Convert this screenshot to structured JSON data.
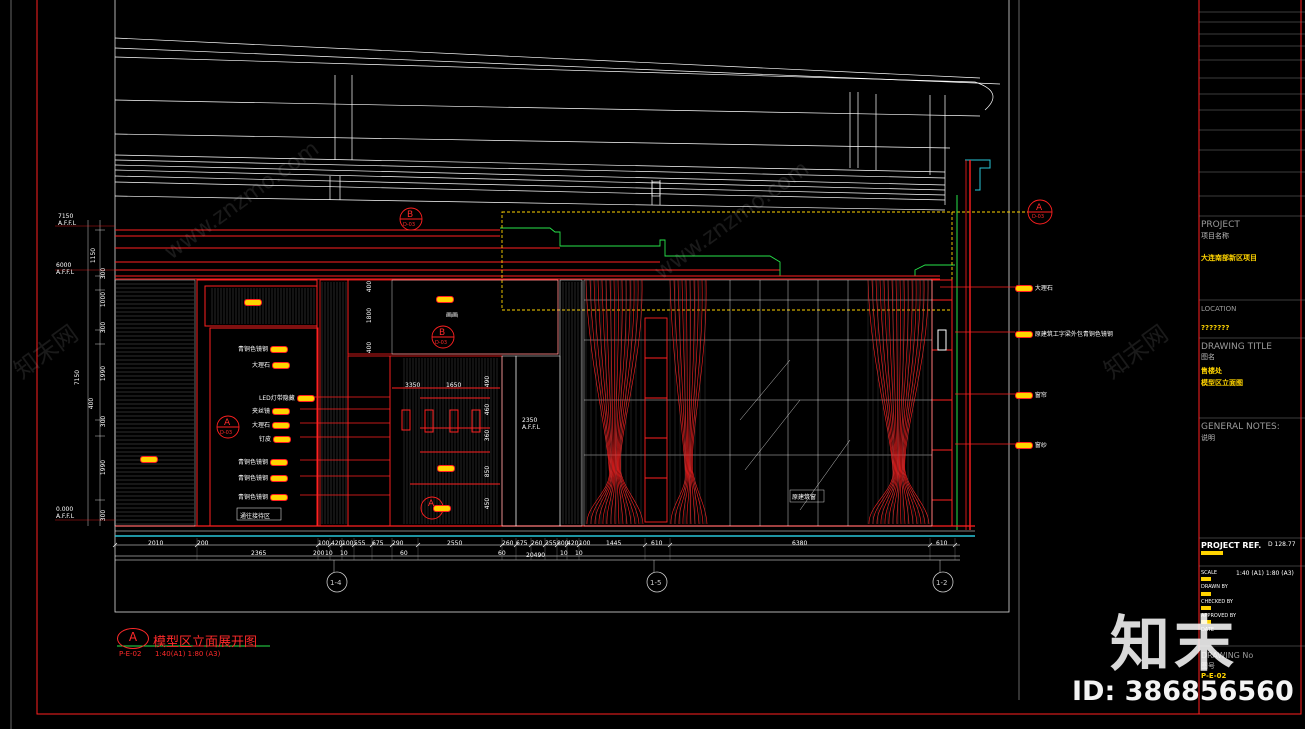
{
  "drawing": {
    "title": "模型区立面展开图",
    "scale": "1:40(A1)  1:80 (A3)",
    "ref": "P-E-02",
    "section_letter": "A"
  },
  "title_block": {
    "project_label": "PROJECT",
    "project_cn": "项目名称",
    "project_value": "大连南部新区项目",
    "location_label": "LOCATION",
    "location_value": "???????",
    "drawing_title_label": "DRAWING TITLE",
    "drawing_title_cn": "图名",
    "drawing_title_value_1": "售楼处",
    "drawing_title_value_2": "模型区立面图",
    "general_notes_label": "GENERAL NOTES:",
    "general_notes_cn": "说明",
    "project_ref_label": "PROJECT REF.",
    "project_ref_value": "D 128.77",
    "scale_label": "SCALE",
    "scale_value": "1:40 (A1) 1:80 (A3)",
    "drawn_by_label": "DRAWN BY",
    "checked_by_label": "CHECKED BY",
    "approved_by_label": "APPROVED BY",
    "date_label": "DATE",
    "drawing_no_label": "DRAWING No",
    "drawing_no_cn": "图号",
    "drawing_no_value": "P-E-02"
  },
  "watermark": {
    "logo": "知末",
    "id": "ID: 386856560",
    "site": "www.znzmo.com",
    "site_cn": "知末网"
  },
  "elevations": [
    {
      "value": "7150",
      "label": "A.F.F.L"
    },
    {
      "value": "6000",
      "label": "A.F.F.L"
    },
    {
      "value": "0.000",
      "label": "A.F.F.L"
    },
    {
      "value": "2350",
      "label": "A.F.F.L"
    }
  ],
  "vertical_dims": [
    "1150",
    "300",
    "1000",
    "300",
    "1990",
    "300",
    "400",
    "1990",
    "300",
    "7150"
  ],
  "horizontal_dims_top": [
    "2010",
    "200",
    "100",
    "420",
    "100",
    "555",
    "675",
    "290",
    "2550",
    "260",
    "675",
    "260",
    "355",
    "800",
    "420",
    "100",
    "1445",
    "610",
    "6380",
    "610"
  ],
  "horizontal_dims_bottom": [
    "2365",
    "200",
    "10",
    "10",
    "60",
    "60",
    "20490",
    "10",
    "10"
  ],
  "grid_axes": [
    "1-4",
    "1-5",
    "1-2"
  ],
  "section_markers": [
    "B",
    "B",
    "A",
    "A",
    "A"
  ],
  "section_marker_ref": "D-03",
  "notes_left": [
    "青铜色镜钢",
    "大理石",
    "LED灯带隐藏",
    "夹丝镜",
    "大理石",
    "钉皮",
    "青铜色镜钢",
    "青铜色镜钢",
    "青铜色镜钢"
  ],
  "notes_right": [
    "大理石",
    "原建筑工字梁外包青铜色镜钢",
    "窗帘",
    "窗纱"
  ],
  "labels": {
    "painting": "画画",
    "glass": "原建筑窗",
    "zone": "通往接待区"
  },
  "inner_dims": [
    "1650",
    "3350",
    "400",
    "400",
    "1800",
    "850",
    "490",
    "460",
    "360",
    "450"
  ],
  "colors": {
    "frame": "#ff2020",
    "linework": "#ffffff",
    "accent_yellow": "#ffd400",
    "green": "#27e34a",
    "cyan": "#29c6d9",
    "background": "#000000"
  }
}
